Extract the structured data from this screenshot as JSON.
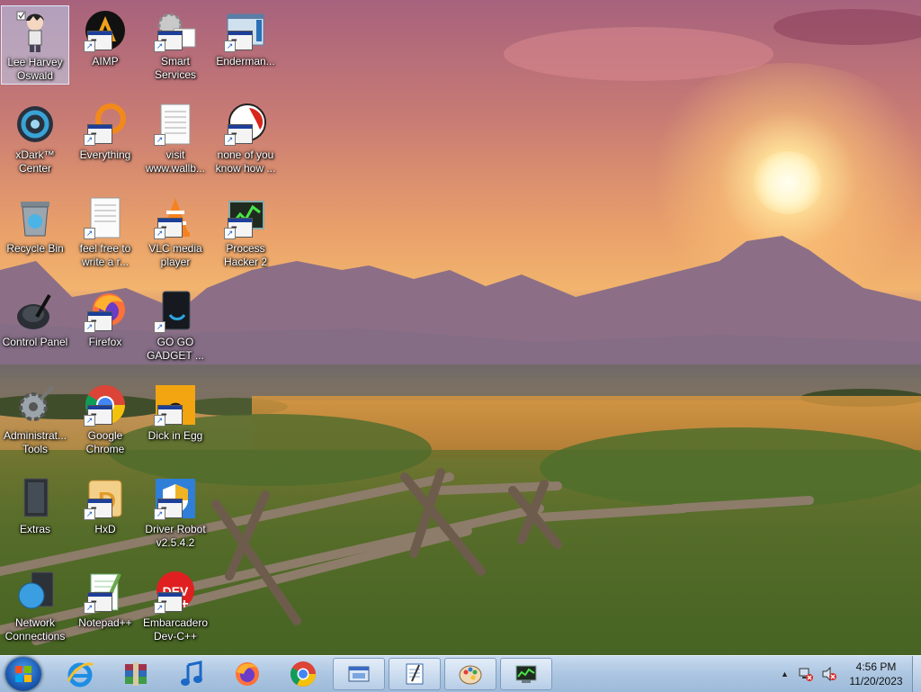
{
  "desktop": {
    "icons": [
      {
        "name": "lee-harvey-oswald-icon",
        "label": "Lee Harvey\nOswald",
        "selected": true
      },
      {
        "name": "aimp-icon",
        "label": "AIMP"
      },
      {
        "name": "smart-services-icon",
        "label": "Smart\nServices"
      },
      {
        "name": "enderman-icon",
        "label": "Enderman..."
      },
      {
        "name": "xdark-center-icon",
        "label": "xDark™\nCenter"
      },
      {
        "name": "everything-icon",
        "label": "Everything"
      },
      {
        "name": "visit-wallb-icon",
        "label": "visit\nwww.wallb..."
      },
      {
        "name": "none-of-you-icon",
        "label": "none of you\nknow how ..."
      },
      {
        "name": "recycle-bin-icon",
        "label": "Recycle Bin"
      },
      {
        "name": "feel-free-icon",
        "label": "feel free to\nwrite a r..."
      },
      {
        "name": "vlc-icon",
        "label": "VLC media\nplayer"
      },
      {
        "name": "process-hacker-icon",
        "label": "Process\nHacker 2"
      },
      {
        "name": "control-panel-icon",
        "label": "Control Panel"
      },
      {
        "name": "firefox-icon",
        "label": "Firefox"
      },
      {
        "name": "go-go-gadget-icon",
        "label": "GO GO\nGADGET ..."
      },
      {
        "name": "admin-tools-icon",
        "label": "Administrat...\nTools"
      },
      {
        "name": "google-chrome-icon",
        "label": "Google\nChrome"
      },
      {
        "name": "dick-in-egg-icon",
        "label": "Dick in Egg"
      },
      {
        "name": "extras-icon",
        "label": "Extras"
      },
      {
        "name": "hxd-icon",
        "label": "HxD"
      },
      {
        "name": "driver-robot-icon",
        "label": "Driver Robot\nv2.5.4.2"
      },
      {
        "name": "network-connections-icon",
        "label": "Network\nConnections"
      },
      {
        "name": "notepadpp-icon",
        "label": "Notepad++"
      },
      {
        "name": "devcpp-icon",
        "label": "Embarcadero\nDev-C++"
      }
    ]
  },
  "taskbar": {
    "pinned": [
      "internet-explorer-icon",
      "winrar-icon",
      "music-player-icon",
      "firefox-icon",
      "chrome-icon"
    ],
    "open": [
      "window-app-icon",
      "notepad-icon",
      "paint-icon",
      "process-hacker-icon"
    ],
    "clock": {
      "time": "4:56 PM",
      "date": "11/20/2023"
    }
  }
}
